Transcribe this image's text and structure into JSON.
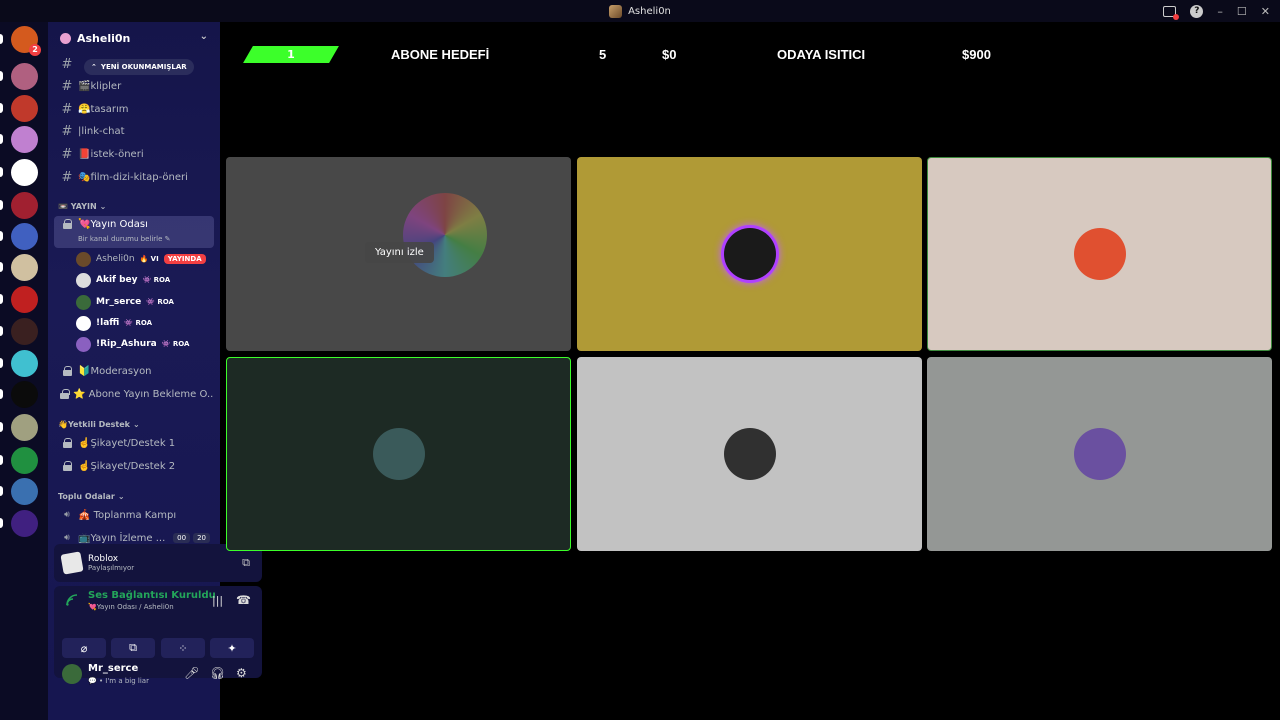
{
  "window": {
    "title": "Asheli0n"
  },
  "servers": [
    {
      "color": "#d45a1e",
      "badge": "2"
    },
    {
      "color": "#b06080",
      "active": true
    },
    {
      "color": "#c0392b"
    },
    {
      "color": "#c080d0"
    },
    {
      "color": "#ffffff"
    },
    {
      "color": "#a02030"
    },
    {
      "color": "#4060c0"
    },
    {
      "color": "#d0c0a0"
    },
    {
      "color": "#c02020"
    },
    {
      "color": "#3a2020"
    },
    {
      "color": "#40c0d0"
    },
    {
      "color": "#0b0b0b"
    },
    {
      "color": "#a0a080"
    },
    {
      "color": "#209040"
    },
    {
      "color": "#3a70b0"
    },
    {
      "color": "#402080"
    }
  ],
  "guild": {
    "name": "Asheli0n"
  },
  "unread_pill": "YENİ OKUNMAMIŞLAR",
  "text_channels": [
    "🎬klipler",
    "😤tasarım",
    "|link-chat",
    "📕istek-öneri",
    "🎭film-dizi-kitap-öneri"
  ],
  "category_yayin": "📼 YAYIN",
  "active_channel": {
    "name": "💘Yayın Odası",
    "sub": "Bir kanal durumu belirle"
  },
  "voice_users": [
    {
      "name": "Asheli0n",
      "extra": "🔥 VI",
      "badge": "YAYINDA",
      "color": "#6a4a2a"
    },
    {
      "name": "Akif bey",
      "extra": "👾 ROA",
      "color": "#dddddd"
    },
    {
      "name": "Mr_serce",
      "extra": "👾 ROA",
      "color": "#3a6a3a"
    },
    {
      "name": "!laffi",
      "extra": "👾 ROA",
      "color": "#ffffff"
    },
    {
      "name": "!Rip_Ashura",
      "extra": "👾 ROA",
      "color": "#8a60c0"
    }
  ],
  "locked_channels": [
    "🔰Moderasyon",
    "⭐ Abone Yayın Bekleme O..."
  ],
  "category_yetkili": "👋Yetkili Destek",
  "support_channels": [
    "☝️Şikayet/Destek 1",
    "☝️Şikayet/Destek 2"
  ],
  "category_toplu": "Toplu Odalar",
  "toplu_channels": [
    {
      "name": "🎪 Toplanma Kampı"
    },
    {
      "name": "📺Yayın İzleme ...",
      "c1": "00",
      "c2": "20"
    }
  ],
  "activity": {
    "game": "Roblox",
    "status": "Paylaşılmıyor"
  },
  "voice": {
    "status": "Ses Bağlantısı Kuruldu",
    "sub": "💘Yayın Odası / Asheli0n"
  },
  "user": {
    "name": "Mr_serce",
    "status": "💬 • I'm a big liar"
  },
  "goal": {
    "number": "1",
    "label": "ABONE HEDEFİ",
    "count": "5",
    "money1": "$0",
    "label2": "ODAYA ISITICI",
    "money2": "$900"
  },
  "watch_label": "Yayını izle",
  "tiles": [
    {
      "bg": "#3a3a3a",
      "stream": true
    },
    {
      "bg": "#b09a36",
      "avatar": "#1a1a1a",
      "ring": true
    },
    {
      "bg": "#d7c9c0",
      "avatar": "#e05030",
      "border": "#3c8a3c"
    },
    {
      "bg": "#1d2a24",
      "avatar": "#3a5a5a",
      "border": "#3cff2a"
    },
    {
      "bg": "#c2c2c2",
      "avatar": "#303030"
    },
    {
      "bg": "#949795",
      "avatar": "#6a50a0"
    }
  ]
}
